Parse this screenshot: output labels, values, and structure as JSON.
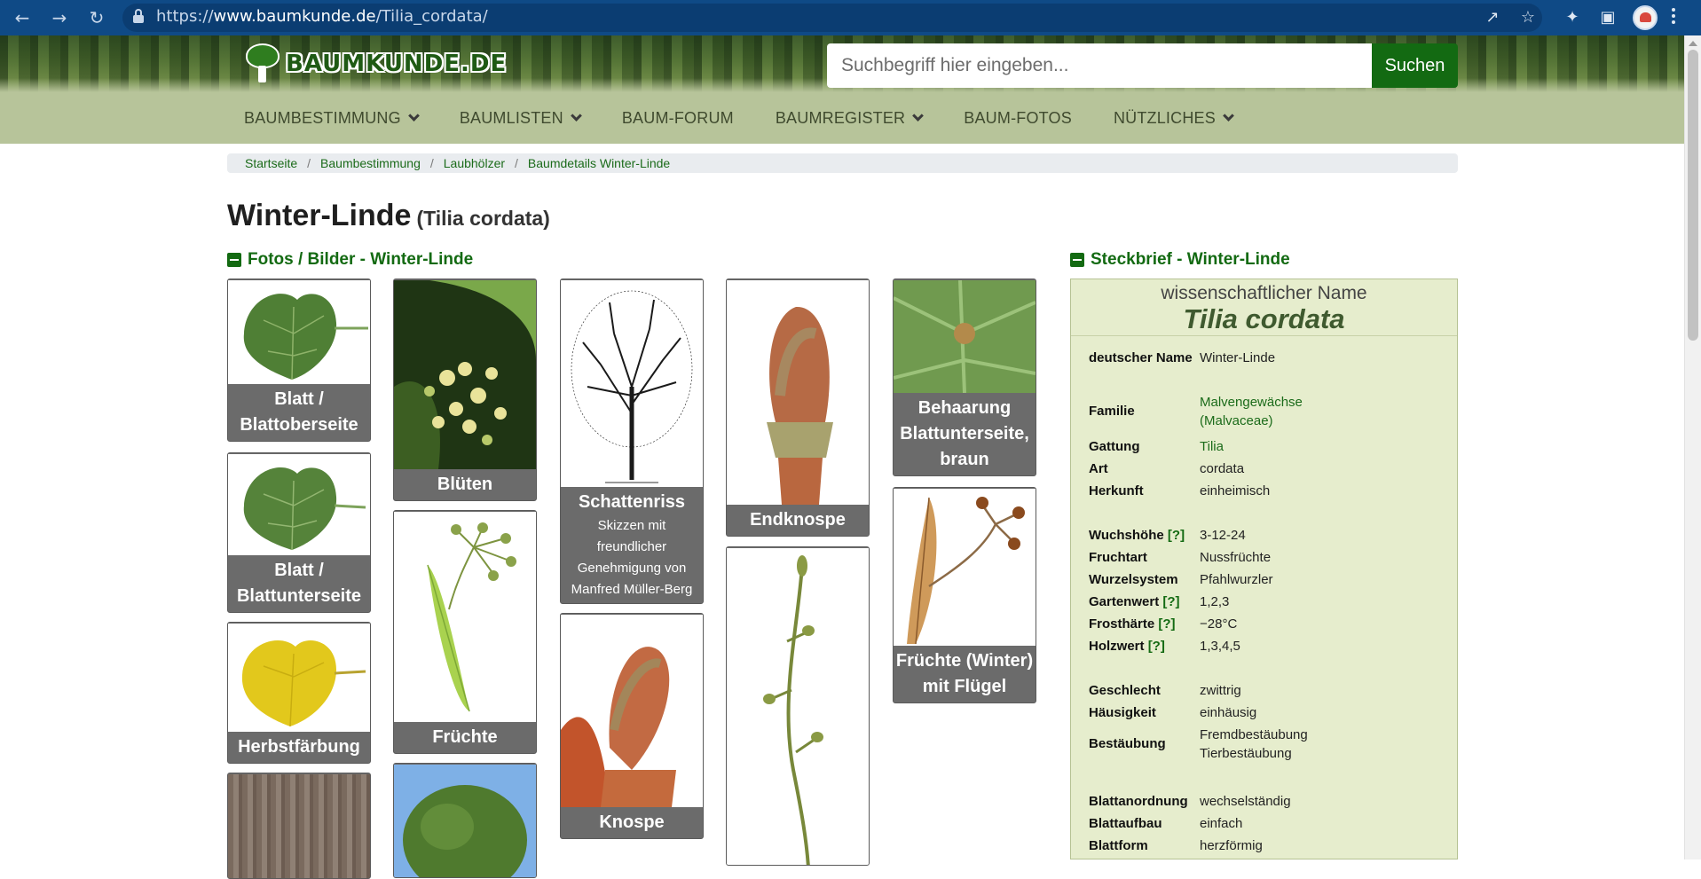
{
  "browser": {
    "url_prefix": "https://",
    "url_host": "www.baumkunde.de",
    "url_path": "/Tilia_cordata/"
  },
  "header": {
    "logo_text": "BAUMKUNDE.DE",
    "search_placeholder": "Suchbegriff hier eingeben...",
    "search_button": "Suchen"
  },
  "nav": [
    {
      "label": "BAUMBESTIMMUNG"
    },
    {
      "label": "BAUMLISTEN"
    },
    {
      "label": "BAUM-FORUM"
    },
    {
      "label": "BAUMREGISTER"
    },
    {
      "label": "BAUM-FOTOS"
    },
    {
      "label": "NÜTZLICHES"
    }
  ],
  "breadcrumb": [
    "Startseite",
    "Baumbestimmung",
    "Laubhölzer",
    "Baumdetails Winter-Linde"
  ],
  "page": {
    "title": "Winter-Linde",
    "subtitle": "(Tilia cordata)"
  },
  "photos": {
    "heading": "Fotos / Bilder - Winter-Linde",
    "cards": [
      {
        "caption": "Blatt / Blattoberseite"
      },
      {
        "caption": "Blatt / Blattunterseite"
      },
      {
        "caption": "Herbstfärbung"
      },
      {
        "caption": "Blüten"
      },
      {
        "caption": "Früchte"
      },
      {
        "caption": "Schattenriss",
        "note": "Skizzen mit freundlicher Genehmigung von Manfred Müller-Berg"
      },
      {
        "caption": "Knospe"
      },
      {
        "caption": "Endknospe"
      },
      {
        "caption": "Behaarung Blattunterseite, braun"
      },
      {
        "caption": "Früchte (Winter) mit Flügel"
      }
    ]
  },
  "steckbrief": {
    "heading": "Steckbrief - Winter-Linde",
    "sci_label": "wissenschaftlicher Name",
    "sci_name": "Tilia cordata",
    "rows": [
      {
        "k": "deutscher Name",
        "v": "Winter-Linde"
      },
      {
        "k": "Familie",
        "v": "Malvengewächse (Malvaceae)"
      },
      {
        "k": "Gattung",
        "v": "Tilia"
      },
      {
        "k": "Art",
        "v": "cordata"
      },
      {
        "k": "Herkunft",
        "v": "einheimisch"
      },
      {
        "k": "Wuchshöhe",
        "v": "3-12-24"
      },
      {
        "k": "Fruchtart",
        "v": "Nussfrüchte"
      },
      {
        "k": "Wurzelsystem",
        "v": "Pfahlwurzler"
      },
      {
        "k": "Gartenwert",
        "v": "1,2,3"
      },
      {
        "k": "Frosthärte",
        "v": "−28°C"
      },
      {
        "k": "Holzwert",
        "v": "1,3,4,5"
      },
      {
        "k": "Geschlecht",
        "v": "zwittrig"
      },
      {
        "k": "Häusigkeit",
        "v": "einhäusig"
      },
      {
        "k": "Bestäubung",
        "v": "Fremdbestäubung Tierbestäubung"
      },
      {
        "k": "Blattanordnung",
        "v": "wechselständig"
      },
      {
        "k": "Blattaufbau",
        "v": "einfach"
      },
      {
        "k": "Blattform",
        "v": "herzförmig"
      }
    ],
    "help_marker": "[?]"
  },
  "colors": {
    "brand_green": "#136a12",
    "nav_bg": "#b7c49a",
    "panel_bg": "#e6edcd",
    "caption_bg": "#6b6b6b"
  }
}
